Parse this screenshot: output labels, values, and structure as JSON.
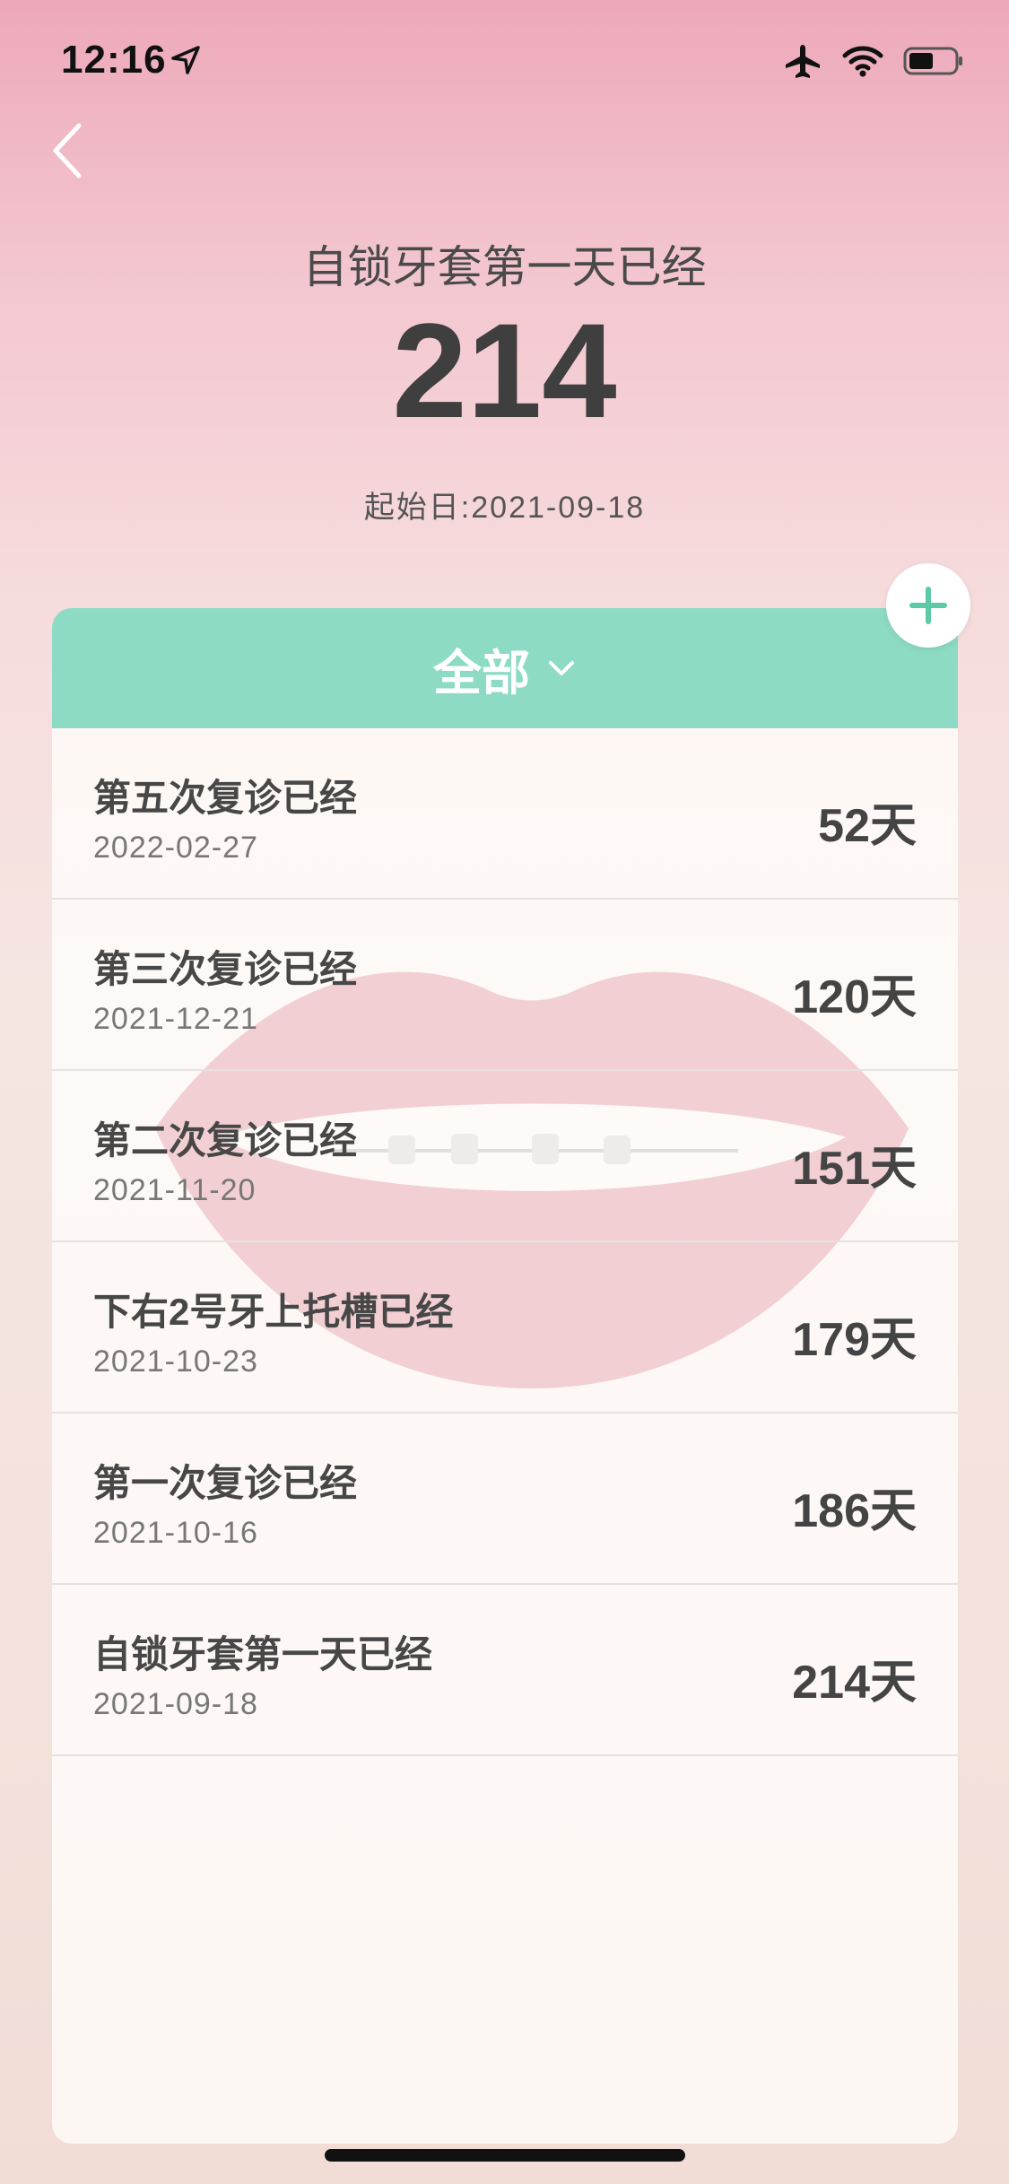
{
  "status_bar": {
    "time": "12:16",
    "icons": [
      "location-arrow-icon",
      "airplane-icon",
      "wifi-icon",
      "battery-icon"
    ]
  },
  "header": {
    "title": "自锁牙套第一天已经",
    "days": "214",
    "start_date": "起始日:2021-09-18"
  },
  "filter": {
    "label": "全部",
    "icon": "chevron-down-icon"
  },
  "add_button": {
    "icon": "plus-icon"
  },
  "items": [
    {
      "title": "第五次复诊已经",
      "date": "2022-02-27",
      "days": "52天"
    },
    {
      "title": "第三次复诊已经",
      "date": "2021-12-21",
      "days": "120天"
    },
    {
      "title": "第二次复诊已经",
      "date": "2021-11-20",
      "days": "151天"
    },
    {
      "title": "下右2号牙上托槽已经",
      "date": "2021-10-23",
      "days": "179天"
    },
    {
      "title": "第一次复诊已经",
      "date": "2021-10-16",
      "days": "186天"
    },
    {
      "title": "自锁牙套第一天已经",
      "date": "2021-09-18",
      "days": "214天"
    }
  ],
  "colors": {
    "accent": "#8ddbc5",
    "plus": "#5cc9a7",
    "text_dark": "#444444"
  }
}
